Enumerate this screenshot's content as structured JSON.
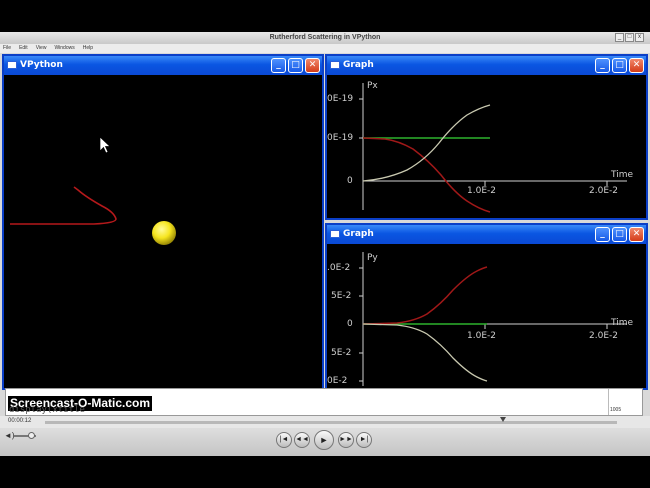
{
  "player": {
    "title": "Rutherford Scattering in VPython",
    "menu": [
      "File",
      "Edit",
      "View",
      "Windows",
      "Help"
    ],
    "current_time": "00:00:12",
    "progress_fraction": 0.8
  },
  "vpython_window": {
    "title": "VPython",
    "minimize": "_",
    "maximize": "□",
    "close": "✕",
    "ball_color": "#f6e51e",
    "trail_color": "#b5191b"
  },
  "graph_px": {
    "title": "Graph",
    "minimize": "_",
    "maximize": "□",
    "close": "✕",
    "ylabel": "Px",
    "xlabel": "Time",
    "y_ticks": [
      "0E-19",
      "0E-19",
      "0"
    ],
    "x_ticks": [
      "1.0E-2",
      "2.0E-2"
    ]
  },
  "graph_py": {
    "title": "Graph",
    "minimize": "_",
    "maximize": "□",
    "close": "✕",
    "ylabel": "Py",
    "xlabel": "Time",
    "y_ticks": [
      ".0E-2",
      "5E-2",
      "0",
      "5E-2",
      "0E-2"
    ],
    "x_ticks": [
      "1.0E-2",
      "2.0E-2"
    ]
  },
  "shell": {
    "watermark": "Screencast-O-Matic.com",
    "text": "display(xtitle",
    "scroll_label": "1005"
  },
  "controls": {
    "volume_icon": "◄)",
    "buttons": [
      "|◄",
      "◄◄",
      "►",
      "►►",
      "►|"
    ]
  }
}
